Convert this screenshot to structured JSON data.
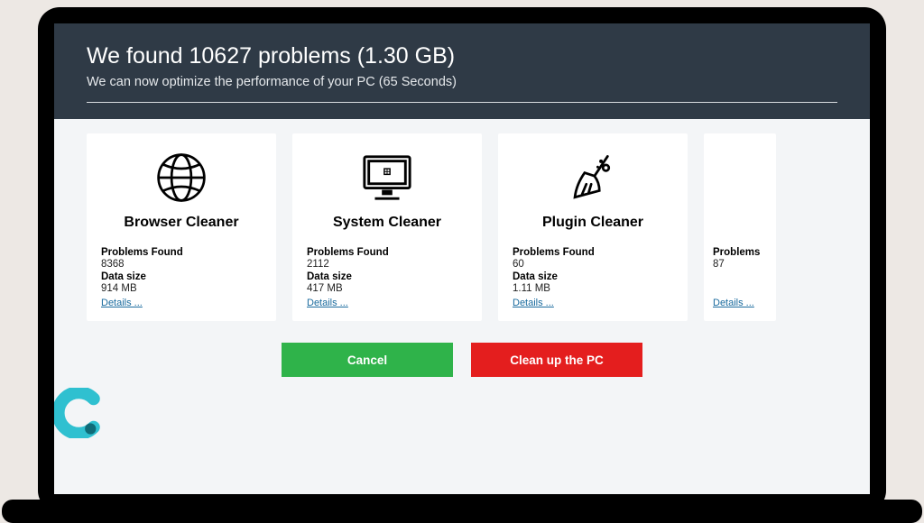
{
  "header": {
    "title": "We found 10627 problems (1.30 GB)",
    "subtitle": "We can now optimize the performance of your PC (65 Seconds)"
  },
  "labels": {
    "problems_found": "Problems Found",
    "data_size": "Data size",
    "details": "Details ..."
  },
  "cards": [
    {
      "title": "Browser Cleaner",
      "problems": "8368",
      "size": "914 MB"
    },
    {
      "title": "System Cleaner",
      "problems": "2112",
      "size": "417 MB"
    },
    {
      "title": "Plugin Cleaner",
      "problems": "60",
      "size": "1.11 MB"
    },
    {
      "title": "",
      "problems": "87",
      "size": ""
    }
  ],
  "actions": {
    "cancel": "Cancel",
    "clean": "Clean up the PC"
  },
  "partial_problems_label": "Problems"
}
